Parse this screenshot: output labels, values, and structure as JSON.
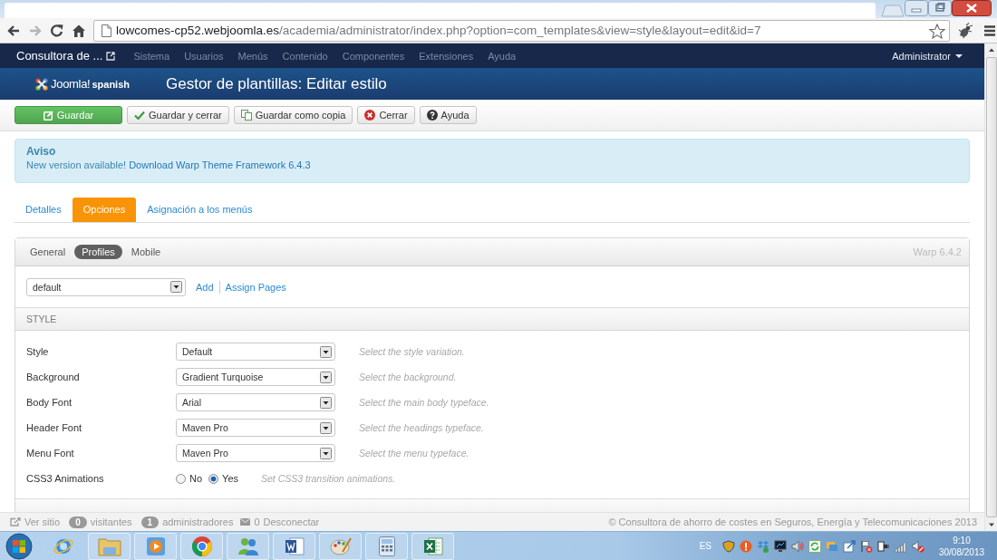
{
  "browser": {
    "url_host": "lowcomes-cp52.webjoomla.es",
    "url_path": "/academia/administrator/index.php?option=com_templates&view=style&layout=edit&id=7"
  },
  "navbar": {
    "site": "Consultora de ...",
    "menu": [
      "Sistema",
      "Usuarios",
      "Menús",
      "Contenido",
      "Componentes",
      "Extensiones",
      "Ayuda"
    ],
    "user": "Administrator"
  },
  "header": {
    "logo": "Joomla!",
    "logo_suffix": "spanish",
    "title": "Gestor de plantillas: Editar estilo"
  },
  "toolbar": [
    {
      "label": "Guardar",
      "kind": "save"
    },
    {
      "label": "Guardar y cerrar",
      "kind": "save-close"
    },
    {
      "label": "Guardar como copia",
      "kind": "copy"
    },
    {
      "label": "Cerrar",
      "kind": "close"
    },
    {
      "label": "Ayuda",
      "kind": "help"
    }
  ],
  "alert": {
    "title": "Aviso",
    "text": "New version available!",
    "link": "Download Warp Theme Framework 6.4.3"
  },
  "tabs": [
    {
      "label": "Detalles",
      "selected": false
    },
    {
      "label": "Opciones",
      "selected": true
    },
    {
      "label": "Asignación a los menús",
      "selected": false
    }
  ],
  "panel": {
    "subtabs": [
      {
        "label": "General",
        "selected": false
      },
      {
        "label": "Profiles",
        "selected": true
      },
      {
        "label": "Mobile",
        "selected": false
      }
    ],
    "version": "Warp 6.4.2",
    "profile": {
      "value": "default",
      "links": [
        "Add",
        "Assign Pages"
      ]
    },
    "sections": [
      {
        "title": "STYLE",
        "rows": [
          {
            "label": "Style",
            "kind": "select",
            "value": "Default",
            "hint": "Select the style variation."
          },
          {
            "label": "Background",
            "kind": "select",
            "value": "Gradient Turquoise",
            "hint": "Select the background."
          },
          {
            "label": "Body Font",
            "kind": "select",
            "value": "Arial",
            "hint": "Select the main body typeface."
          },
          {
            "label": "Header Font",
            "kind": "select",
            "value": "Maven Pro",
            "hint": "Select the headings typeface."
          },
          {
            "label": "Menu Font",
            "kind": "select",
            "value": "Maven Pro",
            "hint": "Select the menu typeface."
          },
          {
            "label": "CSS3 Animations",
            "kind": "radio",
            "options": [
              {
                "label": "No",
                "selected": false
              },
              {
                "label": "Yes",
                "selected": true
              }
            ],
            "hint": "Set CSS3 transition animations."
          }
        ]
      }
    ]
  },
  "footer": {
    "view_site": "Ver sitio",
    "visitors": {
      "count": "0",
      "label": "visitantes"
    },
    "admins": {
      "count": "1",
      "label": "administradores"
    },
    "messages": "0",
    "logout": "Desconectar",
    "copyright": "© Consultora de ahorro de costes en Seguros, Energía y Telecomunicaciones 2013"
  },
  "taskbar": {
    "language": "ES",
    "time": "9:10",
    "date": "30/08/2013"
  }
}
